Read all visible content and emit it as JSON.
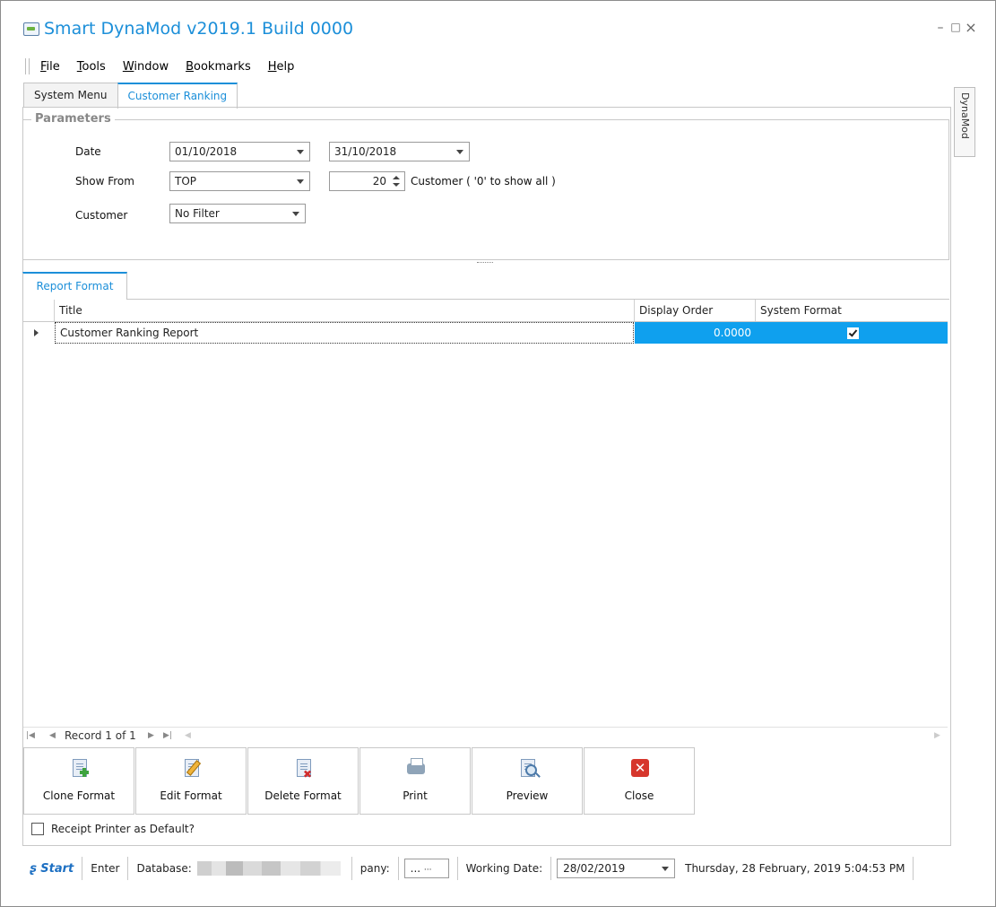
{
  "window": {
    "title": "Smart DynaMod v2019.1 Build 0000",
    "controls": {
      "minimize": "–",
      "maximize": "□",
      "close": "×"
    }
  },
  "menu": [
    {
      "label": "File",
      "u": "F",
      "rest": "ile"
    },
    {
      "label": "Tools",
      "u": "T",
      "rest": "ools"
    },
    {
      "label": "Window",
      "u": "W",
      "rest": "indow"
    },
    {
      "label": "Bookmarks",
      "u": "B",
      "rest": "ookmarks"
    },
    {
      "label": "Help",
      "u": "H",
      "rest": "elp"
    }
  ],
  "tabs": {
    "system_menu": "System Menu",
    "customer_ranking": "Customer Ranking"
  },
  "side_tab": "DynaMod",
  "parameters": {
    "group_title": "Parameters",
    "date_label": "Date",
    "date_from": "01/10/2018",
    "date_to": "31/10/2018",
    "show_from_label": "Show From",
    "show_from_value": "TOP",
    "count_value": "20",
    "count_hint": "Customer ( '0' to show all )",
    "customer_label": "Customer",
    "customer_value": "No Filter"
  },
  "report_tab": "Report Format",
  "grid": {
    "columns": [
      "Title",
      "Display Order",
      "System Format"
    ],
    "rows": [
      {
        "title": "Customer Ranking Report",
        "display_order": "0.0000",
        "system_format": true
      }
    ]
  },
  "navigator": {
    "record_text": "Record 1 of 1"
  },
  "toolbar": {
    "clone": "Clone Format",
    "edit": "Edit Format",
    "delete": "Delete Format",
    "print": "Print",
    "preview": "Preview",
    "close": "Close"
  },
  "receipt_label": "Receipt Printer as Default?",
  "statusbar": {
    "start": "Start",
    "enter": "Enter",
    "database_label": "Database:",
    "company_label": "pany:",
    "company_value": "...",
    "working_date_label": "Working Date:",
    "working_date": "28/02/2019",
    "datetime": "Thursday, 28 February, 2019 5:04:53 PM"
  },
  "colors": {
    "accent": "#1c8fd9",
    "selection": "#0fa0ee"
  }
}
